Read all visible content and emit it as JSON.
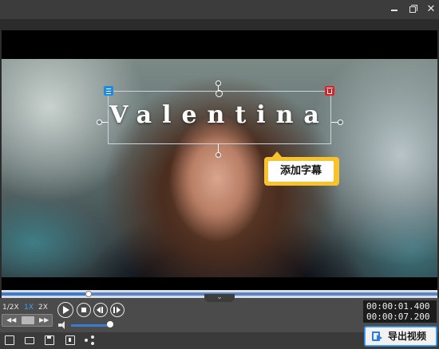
{
  "window": {
    "icons": [
      "minimize-icon",
      "maximize-icon",
      "close-icon"
    ]
  },
  "preview": {
    "subtitle_text": "Valentina",
    "tooltip_label": "添加字幕",
    "icons": [
      "subtitle-list-icon",
      "delete-subtitle-icon"
    ],
    "colors": {
      "list_icon": "#1e8ae0",
      "delete_icon": "#d8222a",
      "tooltip_border": "#f7c22b"
    }
  },
  "playback": {
    "progress_fraction": 0.2,
    "speed_options": [
      "1/2X",
      "1X",
      "2X"
    ],
    "selected_speed": "1X",
    "volume_fraction": 0.9,
    "current_time": "00:00:01.400",
    "total_time": "00:00:07.200",
    "controls": [
      "play-icon",
      "stop-icon",
      "previous-frame-icon",
      "next-frame-icon",
      "volume-icon"
    ]
  },
  "toolbar": {
    "icons": [
      "new-project-icon",
      "open-folder-icon",
      "save-icon",
      "save-as-icon",
      "share-icon"
    ],
    "export_label": "导出视频",
    "accent_color": "#3a7bd5"
  }
}
